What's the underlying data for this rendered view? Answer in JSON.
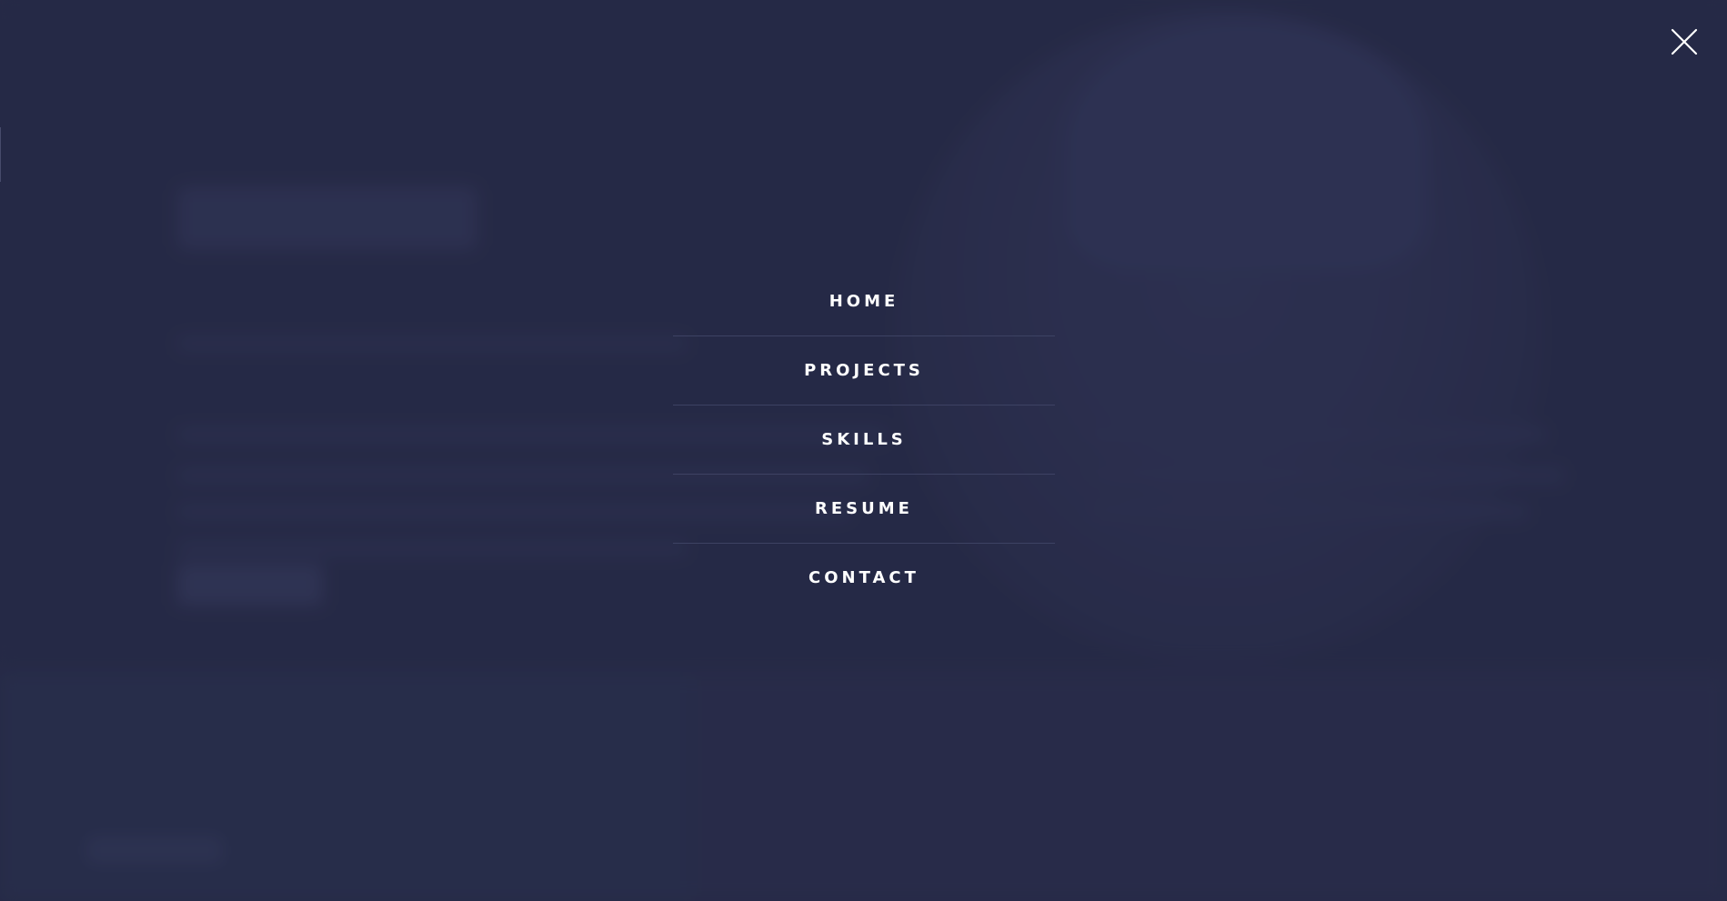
{
  "menu": {
    "items": [
      {
        "label": "HOME"
      },
      {
        "label": "PROJECTS"
      },
      {
        "label": "SKILLS"
      },
      {
        "label": "RESUME"
      },
      {
        "label": "CONTACT"
      }
    ]
  },
  "icons": {
    "close": "close-icon"
  },
  "colors": {
    "background": "#272b48",
    "menu_text": "#ffffff",
    "divider": "#3d4263"
  }
}
